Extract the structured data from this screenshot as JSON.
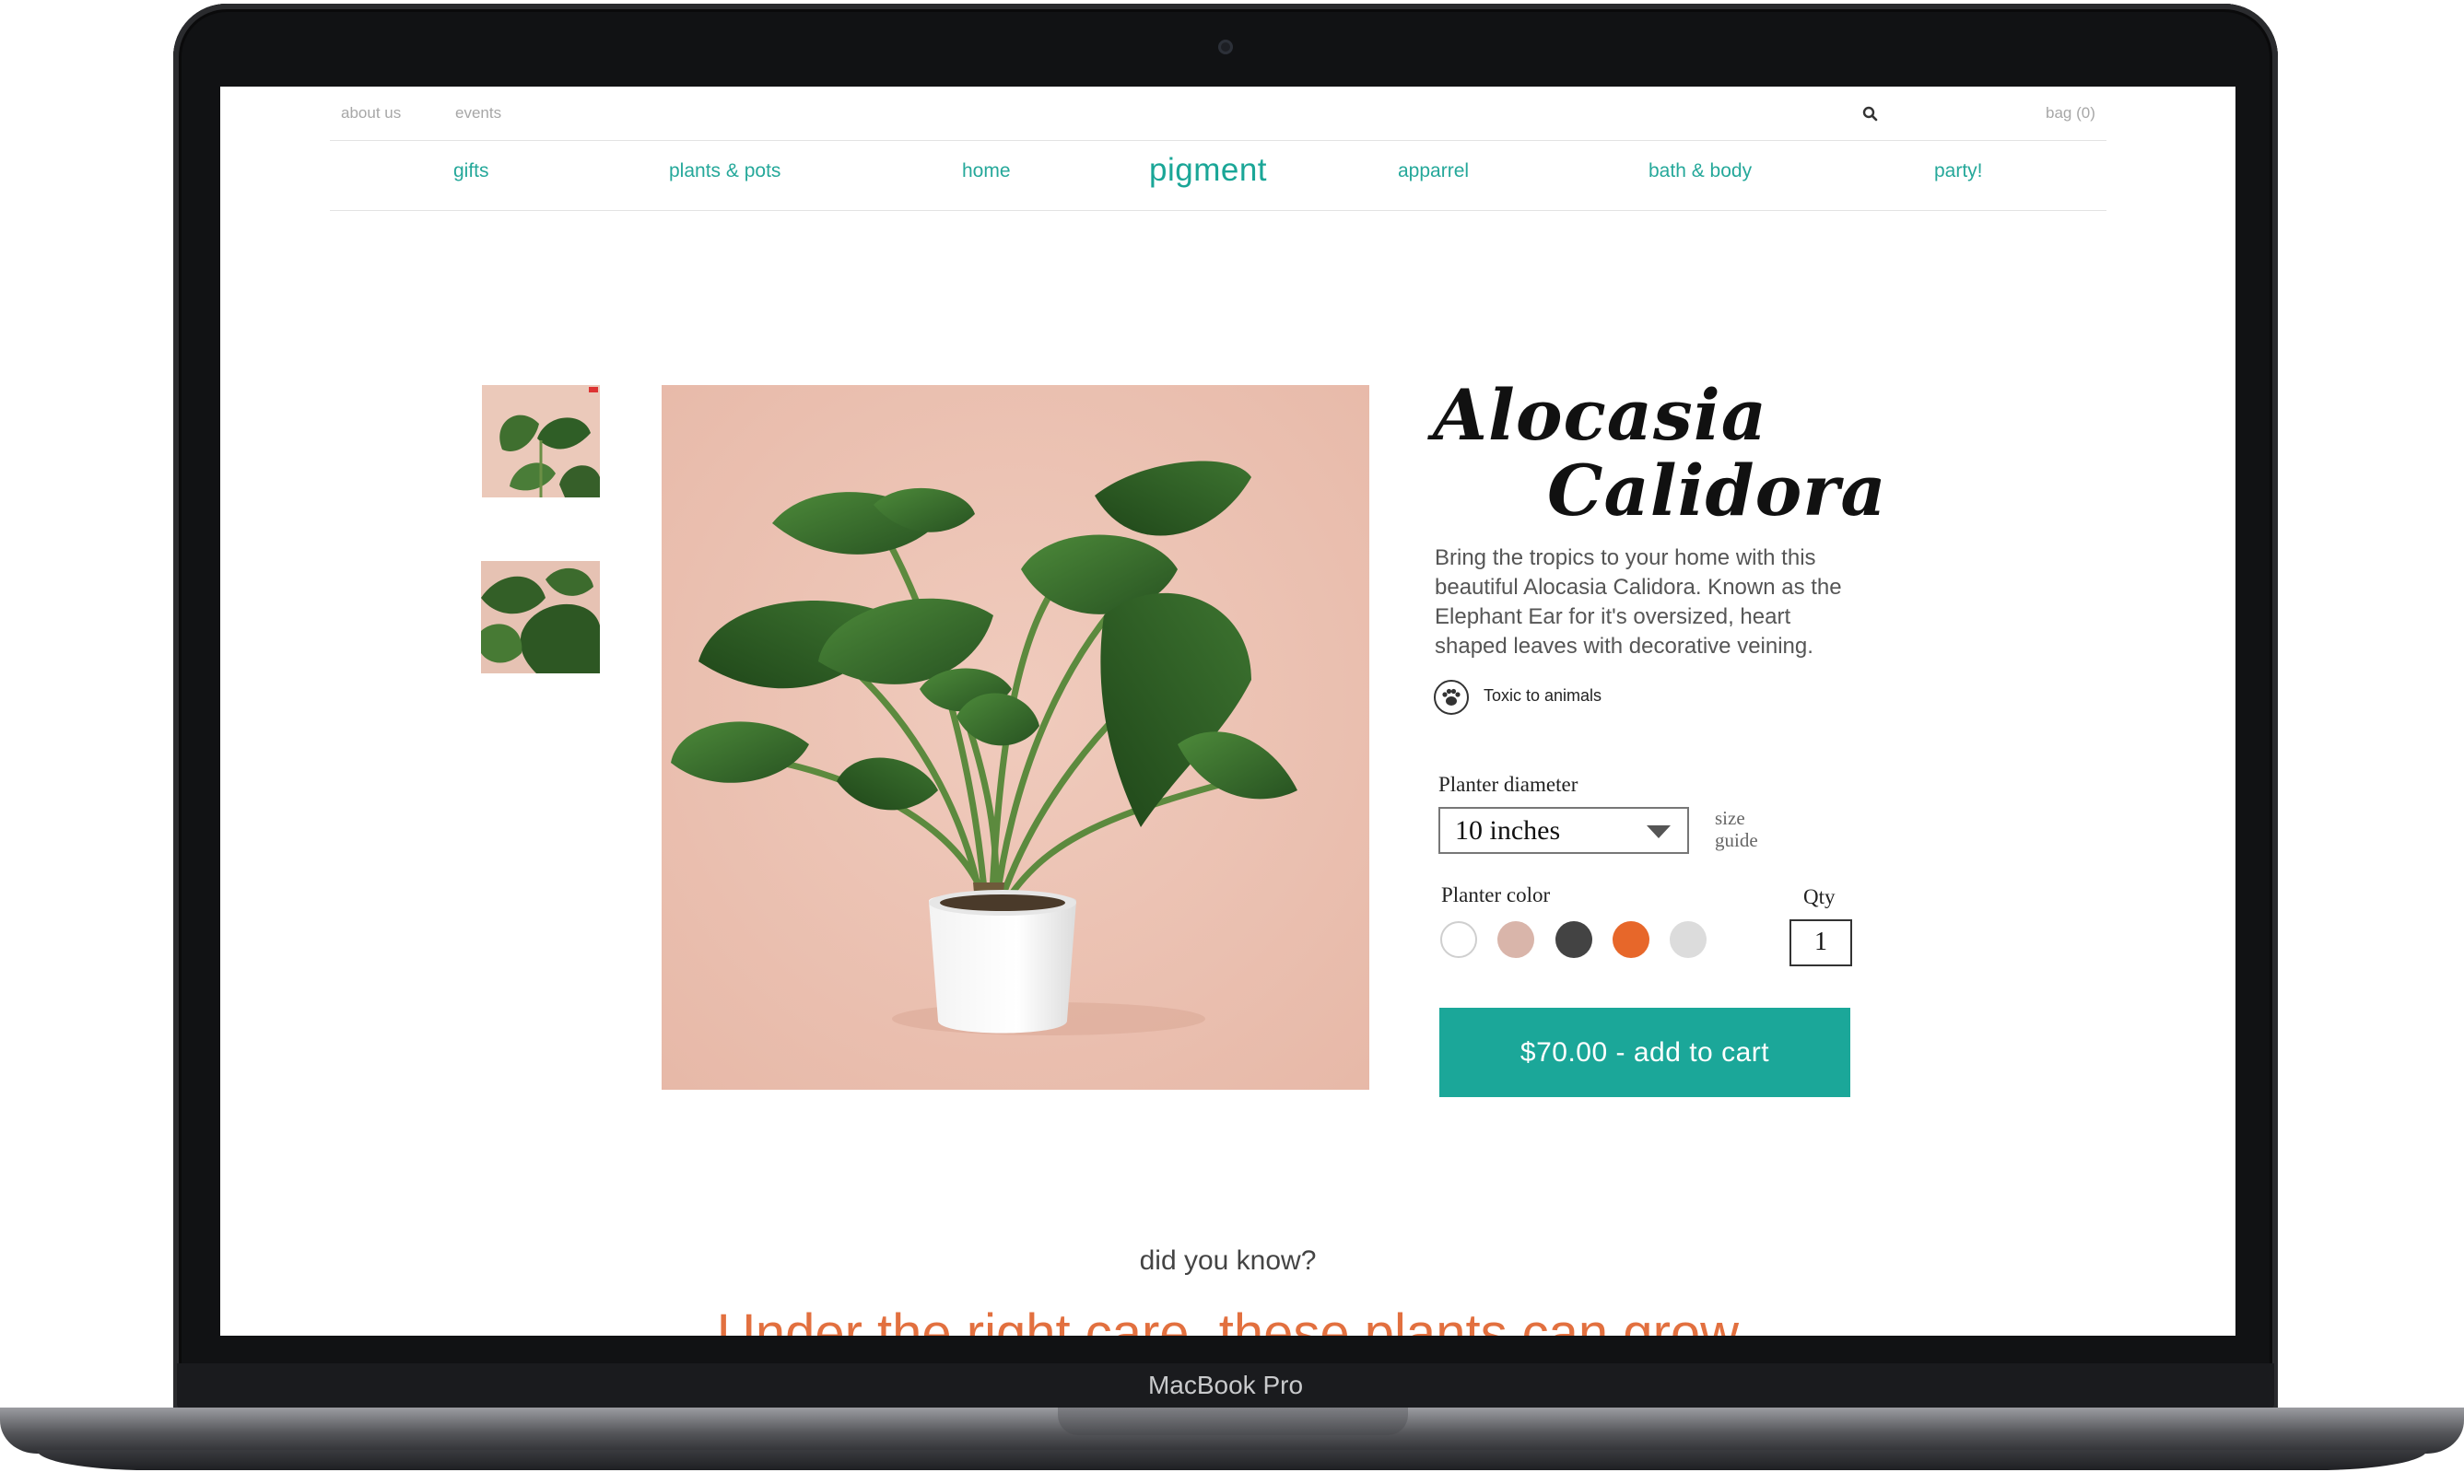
{
  "device": {
    "label": "MacBook Pro"
  },
  "utility_nav": {
    "about": "about us",
    "events": "events",
    "bag": "bag (0)"
  },
  "main_nav": {
    "gifts": "gifts",
    "plants_pots": "plants & pots",
    "home": "home",
    "logo": "pigment",
    "apparrel": "apparrel",
    "bath_body": "bath & body",
    "party": "party!"
  },
  "gallery": {
    "thumbnails": [
      "alocasia-thumbnail-1",
      "alocasia-thumbnail-2"
    ],
    "hero": "alocasia-calidora-product-photo"
  },
  "product": {
    "title_line1": "Alocasia",
    "title_line2": "Calidora",
    "description": "Bring the tropics to your home with this beautiful Alocasia Calidora. Known as the Elephant Ear for it's oversized, heart shaped leaves with decorative veining.",
    "toxic_label": "Toxic to animals",
    "planter_diameter_label": "Planter diameter",
    "planter_diameter_value": "10 inches",
    "size_guide": "size guide",
    "planter_color_label": "Planter color",
    "planter_colors": [
      "#ffffff",
      "#d9b5aa",
      "#434343",
      "#e7672a",
      "#dcdcdc"
    ],
    "qty_label": "Qty",
    "qty_value": "1",
    "cart_button": "$70.00  -  add to cart"
  },
  "did_you_know": {
    "heading": "did you know?",
    "fact_partial": "Under the right care, these plants can grow"
  },
  "colors": {
    "accent": "#1ba799",
    "orange": "#e2703f"
  },
  "icons": {
    "search": "search-icon",
    "toxic": "paw-icon"
  }
}
